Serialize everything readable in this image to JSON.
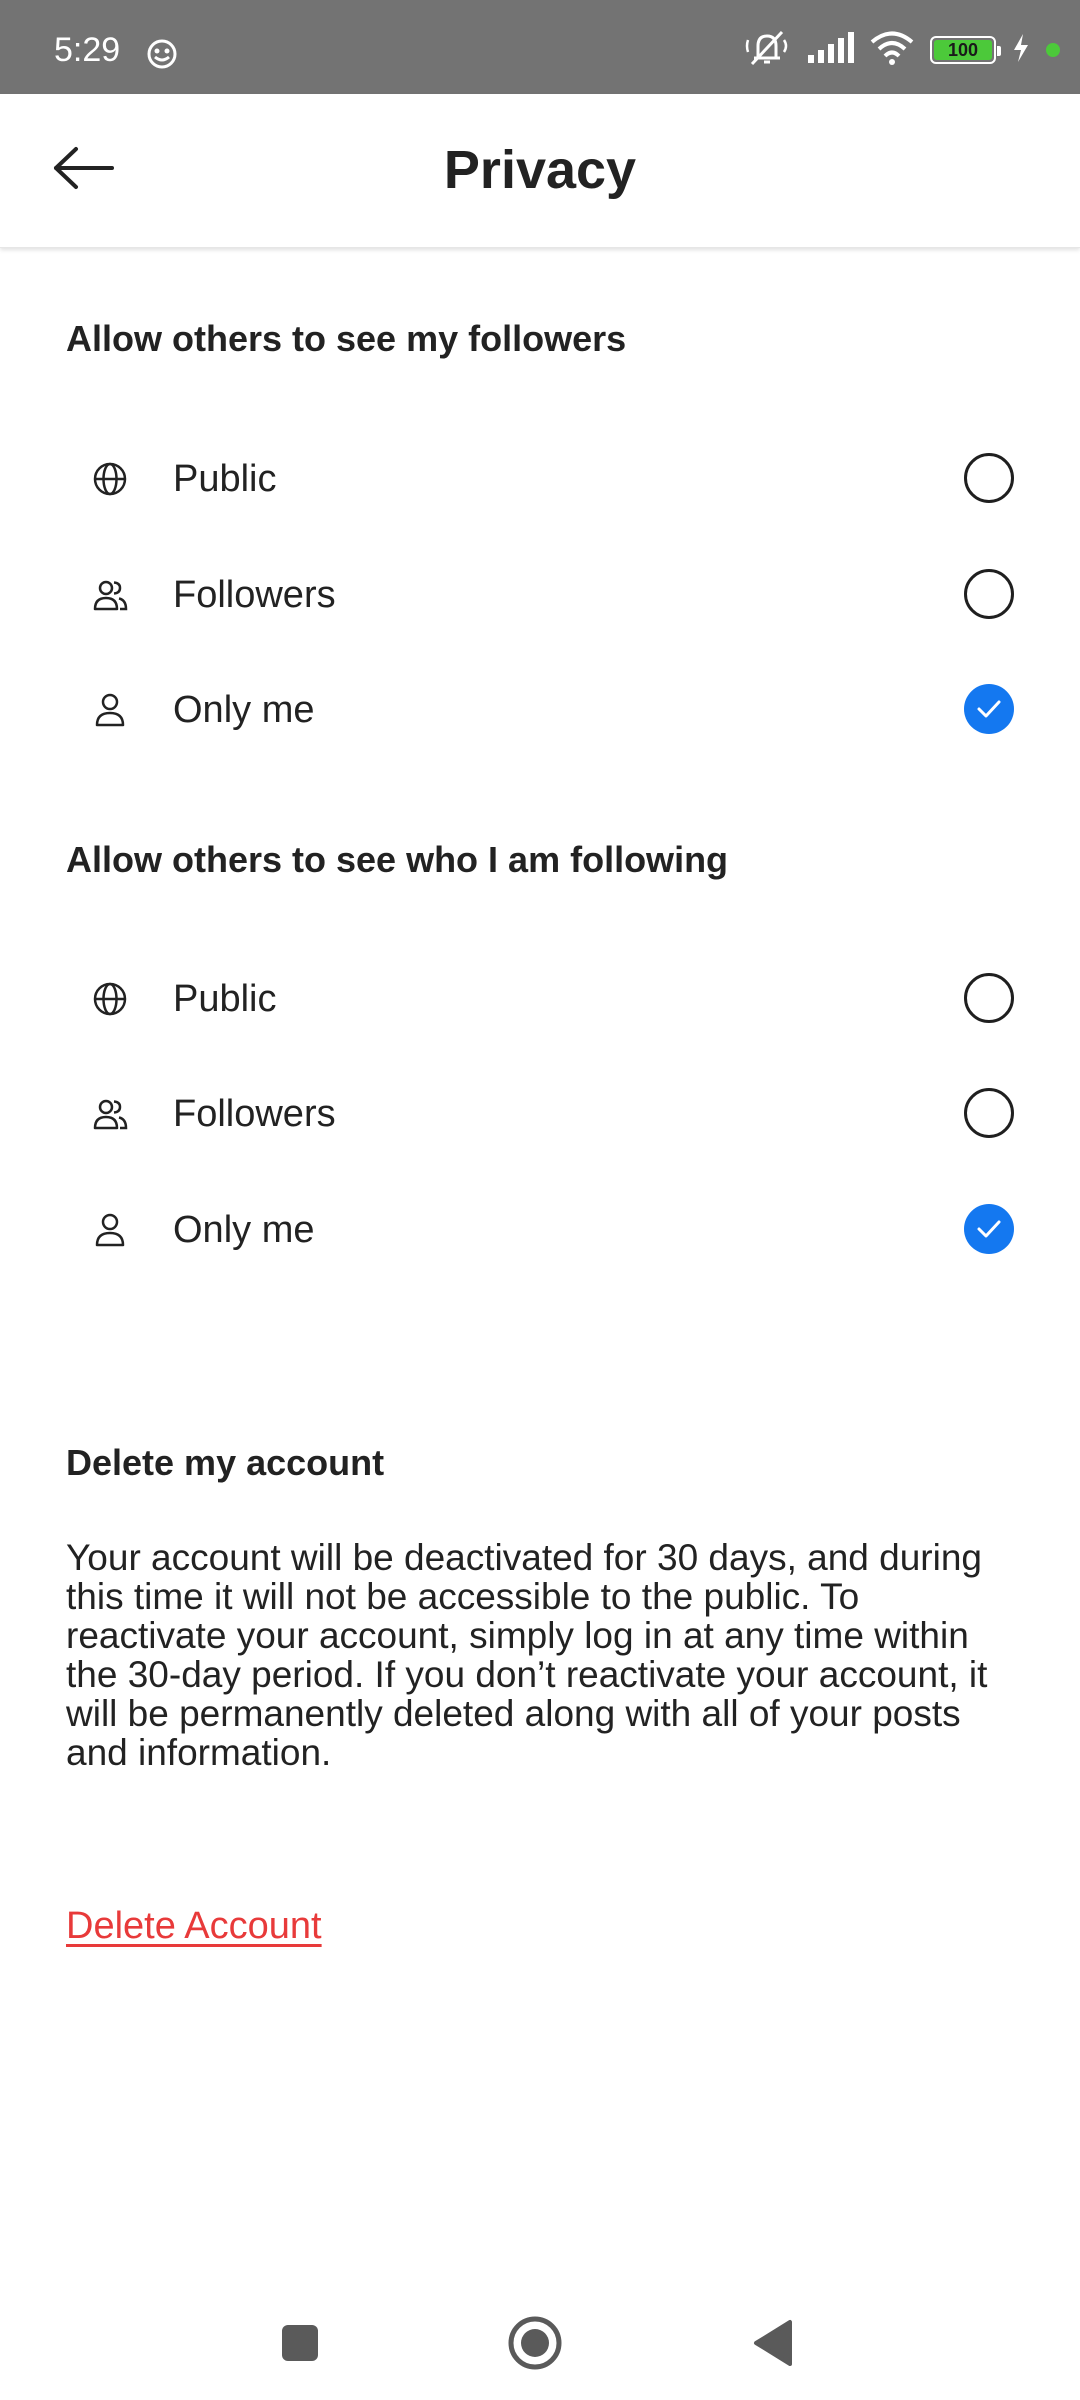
{
  "status_bar": {
    "time": "5:29",
    "battery": "100",
    "icons": [
      "mood-icon",
      "mute-icon",
      "signal-icon",
      "wifi-icon",
      "battery-icon",
      "charging-icon",
      "status-dot-icon"
    ],
    "accent_green": "#4cc93a",
    "background": "#737373"
  },
  "header": {
    "title": "Privacy",
    "back_icon": "arrow-left-icon"
  },
  "followers_section": {
    "title": "Allow others to see my followers",
    "options": [
      {
        "label": "Public",
        "icon": "globe-icon",
        "selected": false
      },
      {
        "label": "Followers",
        "icon": "people-icon",
        "selected": false
      },
      {
        "label": "Only me",
        "icon": "person-icon",
        "selected": true
      }
    ]
  },
  "following_section": {
    "title": "Allow others to see who I am following",
    "options": [
      {
        "label": "Public",
        "icon": "globe-icon",
        "selected": false
      },
      {
        "label": "Followers",
        "icon": "people-icon",
        "selected": false
      },
      {
        "label": "Only me",
        "icon": "person-icon",
        "selected": true
      }
    ]
  },
  "delete_section": {
    "title": "Delete my account",
    "body": "Your account will be deactivated for 30 days, and during this time it will not be accessible to the public. To reactivate your account, simply log in at any time within the 30-day period. If you don’t reactivate your account, it will be permanently deleted along with all of your posts and information.",
    "link": "Delete Account"
  },
  "nav_bar": {
    "buttons": [
      "recents-square-icon",
      "home-circle-icon",
      "back-triangle-icon"
    ]
  },
  "colors": {
    "accent_blue": "#1478f0",
    "danger_red": "#e83a3a",
    "text": "#222222"
  }
}
